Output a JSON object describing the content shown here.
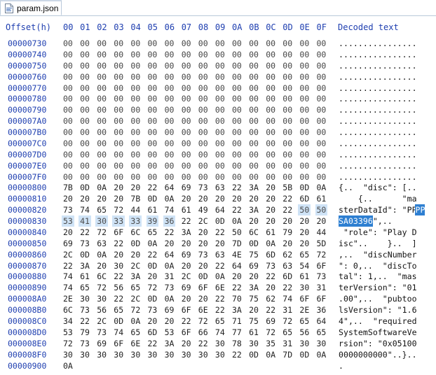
{
  "tab": {
    "label": "param.json",
    "icon": "json-file-icon"
  },
  "header": {
    "offset_label": "Offset(h)",
    "columns": [
      "00",
      "01",
      "02",
      "03",
      "04",
      "05",
      "06",
      "07",
      "08",
      "09",
      "0A",
      "0B",
      "0C",
      "0D",
      "0E",
      "0F"
    ],
    "decoded_label": "Decoded text"
  },
  "rows": [
    {
      "offset": "00000730",
      "bytes": [
        "00",
        "00",
        "00",
        "00",
        "00",
        "00",
        "00",
        "00",
        "00",
        "00",
        "00",
        "00",
        "00",
        "00",
        "00",
        "00"
      ],
      "decoded": "................"
    },
    {
      "offset": "00000740",
      "bytes": [
        "00",
        "00",
        "00",
        "00",
        "00",
        "00",
        "00",
        "00",
        "00",
        "00",
        "00",
        "00",
        "00",
        "00",
        "00",
        "00"
      ],
      "decoded": "................"
    },
    {
      "offset": "00000750",
      "bytes": [
        "00",
        "00",
        "00",
        "00",
        "00",
        "00",
        "00",
        "00",
        "00",
        "00",
        "00",
        "00",
        "00",
        "00",
        "00",
        "00"
      ],
      "decoded": "................"
    },
    {
      "offset": "00000760",
      "bytes": [
        "00",
        "00",
        "00",
        "00",
        "00",
        "00",
        "00",
        "00",
        "00",
        "00",
        "00",
        "00",
        "00",
        "00",
        "00",
        "00"
      ],
      "decoded": "................"
    },
    {
      "offset": "00000770",
      "bytes": [
        "00",
        "00",
        "00",
        "00",
        "00",
        "00",
        "00",
        "00",
        "00",
        "00",
        "00",
        "00",
        "00",
        "00",
        "00",
        "00"
      ],
      "decoded": "................"
    },
    {
      "offset": "00000780",
      "bytes": [
        "00",
        "00",
        "00",
        "00",
        "00",
        "00",
        "00",
        "00",
        "00",
        "00",
        "00",
        "00",
        "00",
        "00",
        "00",
        "00"
      ],
      "decoded": "................"
    },
    {
      "offset": "00000790",
      "bytes": [
        "00",
        "00",
        "00",
        "00",
        "00",
        "00",
        "00",
        "00",
        "00",
        "00",
        "00",
        "00",
        "00",
        "00",
        "00",
        "00"
      ],
      "decoded": "................"
    },
    {
      "offset": "000007A0",
      "bytes": [
        "00",
        "00",
        "00",
        "00",
        "00",
        "00",
        "00",
        "00",
        "00",
        "00",
        "00",
        "00",
        "00",
        "00",
        "00",
        "00"
      ],
      "decoded": "................"
    },
    {
      "offset": "000007B0",
      "bytes": [
        "00",
        "00",
        "00",
        "00",
        "00",
        "00",
        "00",
        "00",
        "00",
        "00",
        "00",
        "00",
        "00",
        "00",
        "00",
        "00"
      ],
      "decoded": "................"
    },
    {
      "offset": "000007C0",
      "bytes": [
        "00",
        "00",
        "00",
        "00",
        "00",
        "00",
        "00",
        "00",
        "00",
        "00",
        "00",
        "00",
        "00",
        "00",
        "00",
        "00"
      ],
      "decoded": "................"
    },
    {
      "offset": "000007D0",
      "bytes": [
        "00",
        "00",
        "00",
        "00",
        "00",
        "00",
        "00",
        "00",
        "00",
        "00",
        "00",
        "00",
        "00",
        "00",
        "00",
        "00"
      ],
      "decoded": "................"
    },
    {
      "offset": "000007E0",
      "bytes": [
        "00",
        "00",
        "00",
        "00",
        "00",
        "00",
        "00",
        "00",
        "00",
        "00",
        "00",
        "00",
        "00",
        "00",
        "00",
        "00"
      ],
      "decoded": "................"
    },
    {
      "offset": "000007F0",
      "bytes": [
        "00",
        "00",
        "00",
        "00",
        "00",
        "00",
        "00",
        "00",
        "00",
        "00",
        "00",
        "00",
        "00",
        "00",
        "00",
        "00"
      ],
      "decoded": "................"
    },
    {
      "offset": "00000800",
      "bytes": [
        "7B",
        "0D",
        "0A",
        "20",
        "20",
        "22",
        "64",
        "69",
        "73",
        "63",
        "22",
        "3A",
        "20",
        "5B",
        "0D",
        "0A"
      ],
      "decoded": "{..  \"disc\": [.."
    },
    {
      "offset": "00000810",
      "bytes": [
        "20",
        "20",
        "20",
        "20",
        "7B",
        "0D",
        "0A",
        "20",
        "20",
        "20",
        "20",
        "20",
        "20",
        "22",
        "6D",
        "61"
      ],
      "decoded": "    {..      \"ma"
    },
    {
      "offset": "00000820",
      "bytes": [
        "73",
        "74",
        "65",
        "72",
        "44",
        "61",
        "74",
        "61",
        "49",
        "64",
        "22",
        "3A",
        "20",
        "22",
        "50",
        "50"
      ],
      "decoded": "sterDataId\": \"PP",
      "sel_from": 14,
      "sel_to": 16
    },
    {
      "offset": "00000830",
      "bytes": [
        "53",
        "41",
        "30",
        "33",
        "33",
        "39",
        "36",
        "22",
        "2C",
        "0D",
        "0A",
        "20",
        "20",
        "20",
        "20",
        "20"
      ],
      "decoded": "SA03396\",..     ",
      "sel_from": 0,
      "sel_to": 7
    },
    {
      "offset": "00000840",
      "bytes": [
        "20",
        "22",
        "72",
        "6F",
        "6C",
        "65",
        "22",
        "3A",
        "20",
        "22",
        "50",
        "6C",
        "61",
        "79",
        "20",
        "44"
      ],
      "decoded": " \"role\": \"Play D"
    },
    {
      "offset": "00000850",
      "bytes": [
        "69",
        "73",
        "63",
        "22",
        "0D",
        "0A",
        "20",
        "20",
        "20",
        "20",
        "7D",
        "0D",
        "0A",
        "20",
        "20",
        "5D"
      ],
      "decoded": "isc\"..    }..  ]"
    },
    {
      "offset": "00000860",
      "bytes": [
        "2C",
        "0D",
        "0A",
        "20",
        "20",
        "22",
        "64",
        "69",
        "73",
        "63",
        "4E",
        "75",
        "6D",
        "62",
        "65",
        "72"
      ],
      "decoded": ",..  \"discNumber"
    },
    {
      "offset": "00000870",
      "bytes": [
        "22",
        "3A",
        "20",
        "30",
        "2C",
        "0D",
        "0A",
        "20",
        "20",
        "22",
        "64",
        "69",
        "73",
        "63",
        "54",
        "6F"
      ],
      "decoded": "\": 0,..  \"discTo"
    },
    {
      "offset": "00000880",
      "bytes": [
        "74",
        "61",
        "6C",
        "22",
        "3A",
        "20",
        "31",
        "2C",
        "0D",
        "0A",
        "20",
        "20",
        "22",
        "6D",
        "61",
        "73"
      ],
      "decoded": "tal\": 1,..  \"mas"
    },
    {
      "offset": "00000890",
      "bytes": [
        "74",
        "65",
        "72",
        "56",
        "65",
        "72",
        "73",
        "69",
        "6F",
        "6E",
        "22",
        "3A",
        "20",
        "22",
        "30",
        "31"
      ],
      "decoded": "terVersion\": \"01"
    },
    {
      "offset": "000008A0",
      "bytes": [
        "2E",
        "30",
        "30",
        "22",
        "2C",
        "0D",
        "0A",
        "20",
        "20",
        "22",
        "70",
        "75",
        "62",
        "74",
        "6F",
        "6F"
      ],
      "decoded": ".00\",..  \"pubtoo"
    },
    {
      "offset": "000008B0",
      "bytes": [
        "6C",
        "73",
        "56",
        "65",
        "72",
        "73",
        "69",
        "6F",
        "6E",
        "22",
        "3A",
        "20",
        "22",
        "31",
        "2E",
        "36"
      ],
      "decoded": "lsVersion\": \"1.6"
    },
    {
      "offset": "000008C0",
      "bytes": [
        "34",
        "22",
        "2C",
        "0D",
        "0A",
        "20",
        "20",
        "22",
        "72",
        "65",
        "71",
        "75",
        "69",
        "72",
        "65",
        "64"
      ],
      "decoded": "4\",..  \"required"
    },
    {
      "offset": "000008D0",
      "bytes": [
        "53",
        "79",
        "73",
        "74",
        "65",
        "6D",
        "53",
        "6F",
        "66",
        "74",
        "77",
        "61",
        "72",
        "65",
        "56",
        "65"
      ],
      "decoded": "SystemSoftwareVe"
    },
    {
      "offset": "000008E0",
      "bytes": [
        "72",
        "73",
        "69",
        "6F",
        "6E",
        "22",
        "3A",
        "20",
        "22",
        "30",
        "78",
        "30",
        "35",
        "31",
        "30",
        "30"
      ],
      "decoded": "rsion\": \"0x05100"
    },
    {
      "offset": "000008F0",
      "bytes": [
        "30",
        "30",
        "30",
        "30",
        "30",
        "30",
        "30",
        "30",
        "30",
        "30",
        "22",
        "0D",
        "0A",
        "7D",
        "0D",
        "0A"
      ],
      "decoded": "0000000000\"..}.."
    },
    {
      "offset": "00000900",
      "bytes": [
        "0A"
      ],
      "decoded": "."
    }
  ],
  "colors": {
    "offset": "#1f3fb0",
    "selection_bytes": "#cfe3f6",
    "selection_text": "#2e7fd1"
  }
}
